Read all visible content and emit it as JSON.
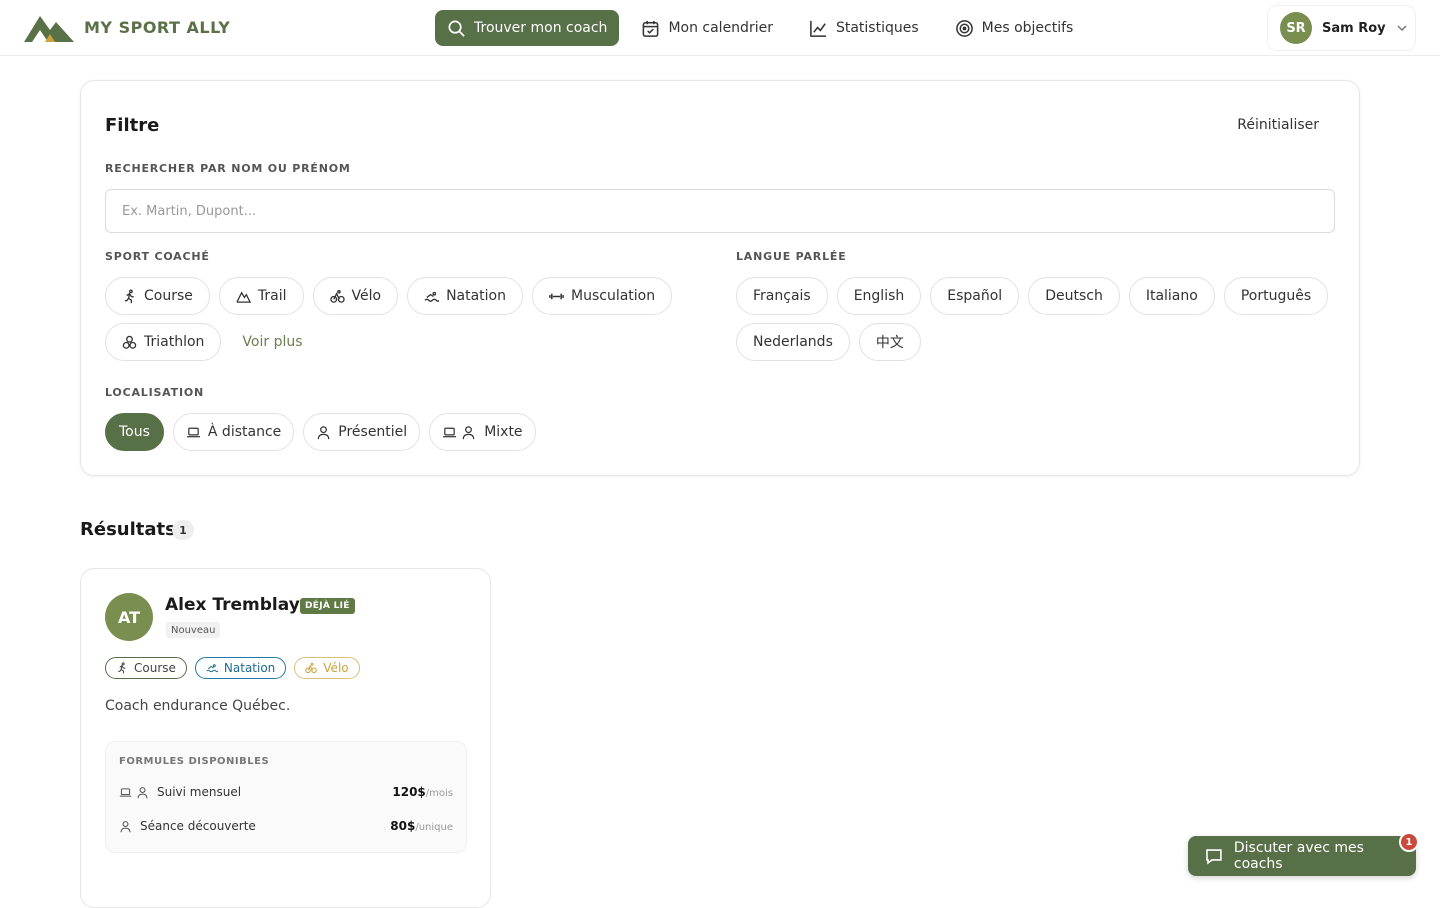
{
  "brand": {
    "name": "MY SPORT ALLY"
  },
  "nav": {
    "items": [
      {
        "label": "Trouver mon coach",
        "active": true
      },
      {
        "label": "Mon calendrier",
        "active": false
      },
      {
        "label": "Statistiques",
        "active": false
      },
      {
        "label": "Mes objectifs",
        "active": false
      }
    ]
  },
  "user": {
    "initials": "SR",
    "name": "Sam Roy"
  },
  "filter": {
    "title": "Filtre",
    "reset_label": "Réinitialiser",
    "search_label": "RECHERCHER PAR NOM OU PRÉNOM",
    "search_placeholder": "Ex. Martin, Dupont...",
    "sport_label": "SPORT COACHÉ",
    "sports": [
      "Course",
      "Trail",
      "Vélo",
      "Natation",
      "Musculation",
      "Triathlon"
    ],
    "more_label": "Voir plus",
    "language_label": "LANGUE PARLÉE",
    "languages": [
      "Français",
      "English",
      "Español",
      "Deutsch",
      "Italiano",
      "Português",
      "Nederlands",
      "中文"
    ],
    "location_label": "LOCALISATION",
    "locations": [
      "Tous",
      "À distance",
      "Présentiel",
      "Mixte"
    ],
    "active_location": "Tous"
  },
  "results": {
    "title": "Résultats",
    "count": "1",
    "coaches": [
      {
        "initials": "AT",
        "name": "Alex Tremblay",
        "linked_badge": "DÉJÀ LIÉ",
        "status_badge": "Nouveau",
        "sports": [
          "Course",
          "Natation",
          "Vélo"
        ],
        "description": "Coach endurance Québec.",
        "formules_label": "FORMULES DISPONIBLES",
        "formules": [
          {
            "name": "Suivi mensuel",
            "price": "120$",
            "unit": "/mois"
          },
          {
            "name": "Séance découverte",
            "price": "80$",
            "unit": "/unique"
          }
        ]
      }
    ]
  },
  "chat": {
    "label": "Discuter avec mes coachs",
    "unread": "1"
  },
  "colors": {
    "primary": "#577048",
    "avatar": "#7a8f4f",
    "badge": "#c94a3c",
    "natation": "#1f7aa6",
    "velo": "#c9a43a"
  }
}
